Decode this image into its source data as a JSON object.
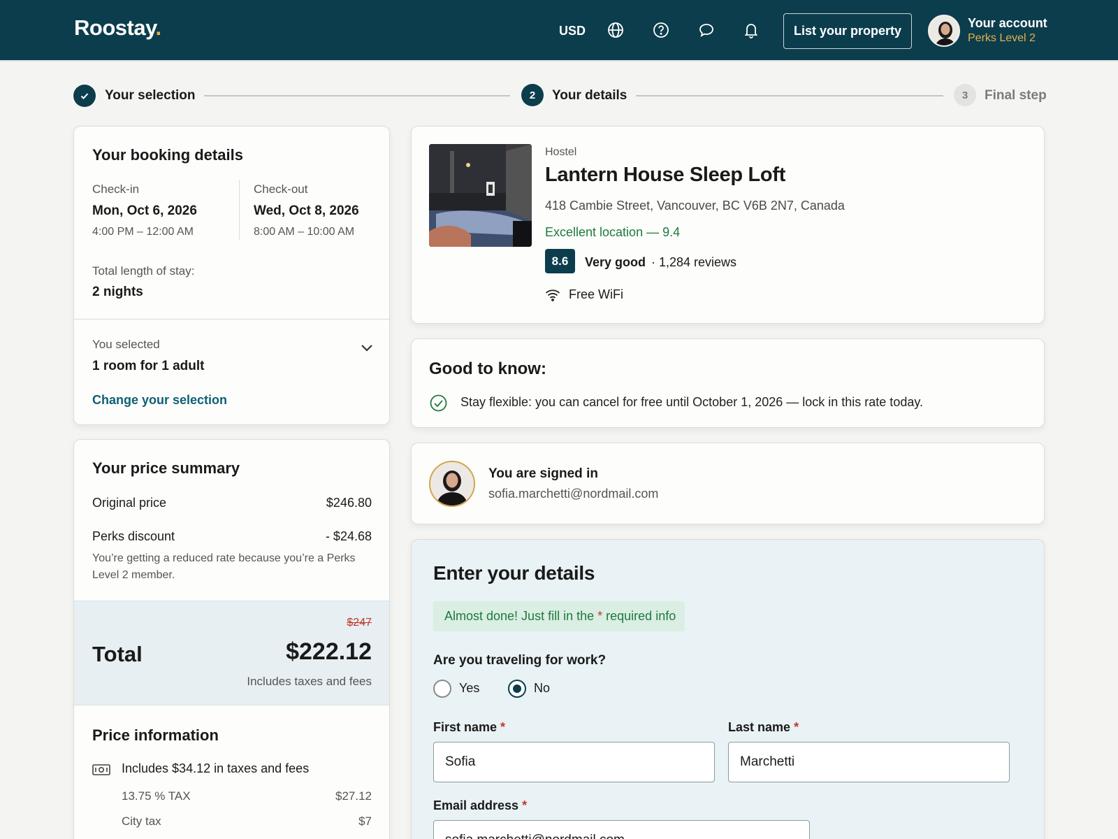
{
  "header": {
    "logo": "Roostay",
    "logo_dot": ".",
    "currency": "USD",
    "list_property": "List your property",
    "account_title": "Your account",
    "account_sub": "Perks Level 2"
  },
  "steps": [
    {
      "label": "Your selection",
      "state": "done"
    },
    {
      "label": "Your details",
      "number": "2",
      "state": "active"
    },
    {
      "label": "Final step",
      "number": "3",
      "state": "todo"
    }
  ],
  "booking": {
    "title": "Your booking details",
    "checkin_label": "Check-in",
    "checkin_date": "Mon, Oct 6, 2026",
    "checkin_time": "4:00 PM – 12:00 AM",
    "checkout_label": "Check-out",
    "checkout_date": "Wed, Oct 8, 2026",
    "checkout_time": "8:00 AM – 10:00 AM",
    "stay_label": "Total length of stay:",
    "stay_value": "2 nights",
    "selected_label": "You selected",
    "selected_value": "1 room for 1 adult",
    "change_link": "Change your selection"
  },
  "price": {
    "title": "Your price summary",
    "original_label": "Original price",
    "original_value": "$246.80",
    "discount_label": "Perks discount",
    "discount_value": "- $24.68",
    "discount_note_1": "You’re getting a reduced rate because you’re a Perks",
    "discount_note_2": "Level 2 member.",
    "strike": "$247",
    "total_label": "Total",
    "total_value": "$222.12",
    "total_note": "Includes taxes and fees",
    "info_title": "Price information",
    "info_line": "Includes $34.12 in taxes and fees",
    "tax1_label": "13.75 % TAX",
    "tax1_value": "$27.12",
    "tax2_label": "City tax",
    "tax2_value": "$7"
  },
  "hotel": {
    "type": "Hostel",
    "name": "Lantern House Sleep Loft",
    "address": "418 Cambie Street, Vancouver, BC V6B 2N7, Canada",
    "location": "Excellent location — 9.4",
    "score": "8.6",
    "score_word": "Very good",
    "reviews": "· 1,284 reviews",
    "amenity": "Free WiFi"
  },
  "good_to_know": {
    "title": "Good to know:",
    "text": "Stay flexible: you can cancel for free until October 1, 2026 — lock in this rate today."
  },
  "signed_in": {
    "title": "You are signed in",
    "email": "sofia.marchetti@nordmail.com"
  },
  "form": {
    "title": "Enter your details",
    "notice_pre": "Almost done! Just fill in the ",
    "notice_star": "*",
    "notice_post": " required info",
    "work_question": "Are you traveling for work?",
    "yes": "Yes",
    "no": "No",
    "first_label": "First name",
    "first_value": "Sofia",
    "last_label": "Last name",
    "last_value": "Marchetti",
    "email_label": "Email address",
    "email_value": "sofia.marchetti@nordmail.com",
    "star": "*"
  },
  "colors": {
    "brand": "#0c3d4d",
    "accent": "#e8b04a",
    "link": "#0f5f74",
    "success": "#1d7a3d",
    "error": "#c0392b"
  }
}
